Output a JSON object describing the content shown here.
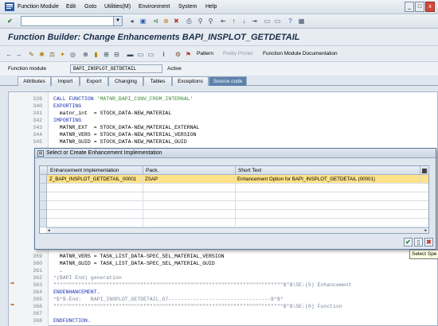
{
  "menu": {
    "items": [
      "Function Module",
      "Edit",
      "Goto",
      "Utilities(M)",
      "Environment",
      "System",
      "Help"
    ]
  },
  "window_controls": [
    "_",
    "□",
    "x"
  ],
  "title": "Function Builder: Change Enhancements BAPI_INSPLOT_GETDETAIL",
  "app_toolbar": {
    "pattern": "Pattern",
    "pretty_printer": "Pretty Printer",
    "fm_doc": "Function Module Documentation"
  },
  "header": {
    "label": "Function module",
    "value": "BAPI_INSPLOT_GETDETAIL",
    "status": "Active"
  },
  "tabs": [
    {
      "label": "Attributes"
    },
    {
      "label": "Import"
    },
    {
      "label": "Export"
    },
    {
      "label": "Changing"
    },
    {
      "label": "Tables"
    },
    {
      "label": "Exceptions"
    },
    {
      "label": "Source code",
      "active": true
    }
  ],
  "code_top": [
    {
      "n": "339",
      "t": "CALL FUNCTION 'MATNR_BAPI_CONV_FROM_INTERNAL'"
    },
    {
      "n": "340",
      "t": "EXPORTING"
    },
    {
      "n": "341",
      "t": "  matnr_int  = STOCK_DATA-NEW_MATERIAL"
    },
    {
      "n": "342",
      "t": "IMPORTING"
    },
    {
      "n": "343",
      "t": "  MATNR_EXT  = STOCK_DATA-NEW_MATERIAL_EXTERNAL"
    },
    {
      "n": "344",
      "t": "  MATNR_VERS = STOCK_DATA-NEW_MATERIAL_VERSION"
    },
    {
      "n": "345",
      "t": "  MATNR_GUID = STOCK_DATA-NEW_MATERIAL_GUID"
    }
  ],
  "code_bottom": [
    {
      "n": "359",
      "t": "  MATNR_VERS = TASK_LIST_DATA-SPEC_SEL_MATERIAL_VERSION"
    },
    {
      "n": "360",
      "t": "  MATNR_GUID = TASK_LIST_DATA-SPEC_SEL_MATERIAL_GUID"
    },
    {
      "n": "361",
      "t": "  ."
    },
    {
      "n": "362",
      "t": "*(BAPI End) generation"
    },
    {
      "n": "363",
      "t": "\"\"\"\"\"\"\"\"\"\"\"\"\"\"\"\"\"\"\"\"\"\"\"\"\"\"\"\"\"\"\"\"\"\"\"\"\"\"\"\"\"\"\"\"\"\"\"\"\"\"\"\"\"\"\"\"\"\"\"\"\"\"\"\"\"\"\"\"\"\"\"\"\"\"$\"$\\SE:(5) Enhancement"
    },
    {
      "n": "364",
      "t": "ENDENHANCEMENT."
    },
    {
      "n": "365",
      "t": "*$*$-End:   BAPI_INSPLOT_GETDETAIL_G7---------------------------------$*$*"
    },
    {
      "n": "366",
      "t": "\"\"\"\"\"\"\"\"\"\"\"\"\"\"\"\"\"\"\"\"\"\"\"\"\"\"\"\"\"\"\"\"\"\"\"\"\"\"\"\"\"\"\"\"\"\"\"\"\"\"\"\"\"\"\"\"\"\"\"\"\"\"\"\"\"\"\"\"\"\"\"\"\"\"$\"$\\SE:(6) Function"
    },
    {
      "n": "367",
      "t": ""
    },
    {
      "n": "368",
      "t": "ENDFUNCTION."
    }
  ],
  "dialog": {
    "title": "Select or Create Enhancement Implementation",
    "columns": [
      "Enhancement Implementation",
      "Pack.",
      "Short Text"
    ],
    "rows": [
      [
        "Z_BAPI_INSPLOT_GETDETAIL_00001",
        "ZSAP",
        "Enhancement Option for BAPI_INSPLOT_GETDETAIL (00001)"
      ]
    ]
  },
  "tooltip": "Select Spe"
}
